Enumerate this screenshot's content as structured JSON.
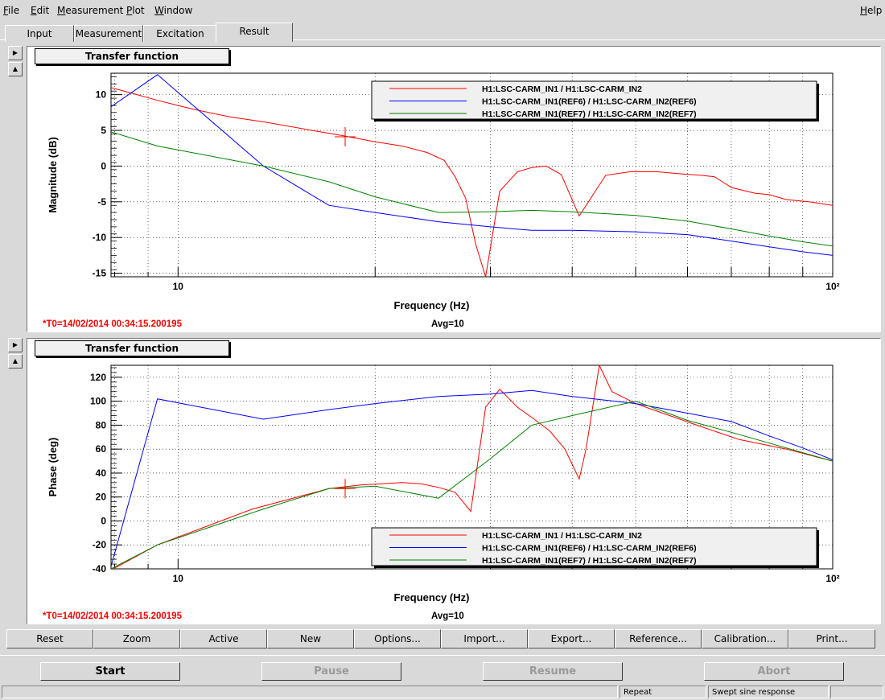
{
  "menubar": {
    "items": [
      {
        "label": "File",
        "key": "F"
      },
      {
        "label": "Edit",
        "key": "E"
      },
      {
        "label": "Measurement",
        "key": "M"
      },
      {
        "label": "Plot",
        "key": "P"
      },
      {
        "label": "Window",
        "key": "W"
      }
    ],
    "help": "Help"
  },
  "tabs": [
    {
      "label": "Input"
    },
    {
      "label": "Measurement"
    },
    {
      "label": "Excitation"
    },
    {
      "label": "Result"
    }
  ],
  "plots": [
    {
      "panel_title": "Transfer function",
      "timestamp": "*T0=14/02/2014 00:34:15.200195",
      "avg": "Avg=10"
    },
    {
      "panel_title": "Transfer function",
      "timestamp": "*T0=14/02/2014 00:34:15.200195",
      "avg": "Avg=10"
    }
  ],
  "chart_data": [
    {
      "type": "line",
      "xlabel": "Frequency (Hz)",
      "ylabel": "Magnitude (dB)",
      "xscale": "log",
      "xlim": [
        7.9,
        100
      ],
      "ylim": [
        -15.5,
        13
      ],
      "xticks": [
        {
          "value": 10,
          "label": "10"
        },
        {
          "value": 100,
          "label": "10²"
        }
      ],
      "yticks": [
        -15,
        -10,
        -5,
        0,
        5,
        10
      ],
      "grid": true,
      "legend_position": "top-right",
      "cursor": {
        "x": 18.0,
        "y": 4.1
      },
      "series": [
        {
          "name": "H1:LSC-CARM_IN1 / H1:LSC-CARM_IN2",
          "color": "#ff0000",
          "x": [
            7.9,
            8.5,
            9.3,
            10.5,
            12,
            13.5,
            16,
            18,
            20,
            22,
            24,
            25.5,
            26.5,
            27.5,
            28.5,
            29.5,
            31,
            33,
            34.7,
            36.5,
            38.5,
            41,
            45,
            49,
            54,
            59,
            63,
            66,
            70,
            76,
            80,
            85,
            92,
            100
          ],
          "y": [
            11,
            10.2,
            9.2,
            8,
            6.9,
            6.2,
            5,
            4.2,
            3.4,
            2.8,
            1.9,
            0.8,
            -1.5,
            -4.5,
            -11,
            -15.5,
            -3.5,
            -0.8,
            -0.2,
            0,
            -1.2,
            -7,
            -1.3,
            -0.8,
            -0.8,
            -1.1,
            -1.3,
            -1.5,
            -3,
            -3.8,
            -4,
            -4.7,
            -5,
            -5.5
          ]
        },
        {
          "name": "H1:LSC-CARM_IN1(REF6) / H1:LSC-CARM_IN2(REF6)",
          "color": "#0000ff",
          "x": [
            7.9,
            9.3,
            13.5,
            17,
            20,
            25,
            30,
            34.7,
            40,
            50,
            60,
            70,
            80,
            90,
            100
          ],
          "y": [
            8.3,
            12.8,
            0,
            -5.5,
            -6.5,
            -7.8,
            -8.5,
            -9,
            -9,
            -9.2,
            -9.6,
            -10.5,
            -11.3,
            -12,
            -12.5
          ]
        },
        {
          "name": "H1:LSC-CARM_IN1(REF7) / H1:LSC-CARM_IN2(REF7)",
          "color": "#008000",
          "x": [
            7.9,
            9.3,
            13.5,
            17,
            20,
            25,
            30,
            34.7,
            40,
            50,
            60,
            70,
            80,
            90,
            100
          ],
          "y": [
            4.8,
            2.8,
            0,
            -2.2,
            -4.3,
            -6.5,
            -6.4,
            -6.2,
            -6.4,
            -6.9,
            -7.7,
            -8.8,
            -9.8,
            -10.6,
            -11.2
          ]
        }
      ]
    },
    {
      "type": "line",
      "xlabel": "Frequency (Hz)",
      "ylabel": "Phase (deg)",
      "xscale": "log",
      "xlim": [
        7.9,
        100
      ],
      "ylim": [
        -40,
        130
      ],
      "xticks": [
        {
          "value": 10,
          "label": "10"
        },
        {
          "value": 100,
          "label": "10²"
        }
      ],
      "yticks": [
        -40,
        -20,
        0,
        20,
        40,
        60,
        80,
        100,
        120
      ],
      "grid": true,
      "legend_position": "bottom-right",
      "cursor": {
        "x": 18.0,
        "y": 27
      },
      "series": [
        {
          "name": "H1:LSC-CARM_IN1 / H1:LSC-CARM_IN2",
          "color": "#ff0000",
          "x": [
            7.9,
            9.3,
            13,
            17,
            19,
            20.5,
            22,
            23.5,
            25,
            26.5,
            28,
            29.5,
            31,
            33,
            35,
            37,
            39,
            41,
            42,
            44,
            46,
            50,
            55,
            62,
            72,
            85,
            100
          ],
          "y": [
            -41,
            -20,
            10,
            27,
            30,
            31,
            32,
            31,
            28,
            24,
            8,
            95,
            110,
            95,
            85,
            75,
            60,
            35,
            60,
            130,
            108,
            98,
            90,
            80,
            68,
            60,
            50
          ]
        },
        {
          "name": "H1:LSC-CARM_IN1(REF6) / H1:LSC-CARM_IN2(REF6)",
          "color": "#0000ff",
          "x": [
            7.9,
            9.3,
            13.5,
            17,
            20,
            25,
            30,
            34.7,
            40,
            50,
            60,
            70,
            80,
            90,
            100
          ],
          "y": [
            -38,
            102,
            85,
            93,
            98,
            104,
            106,
            109,
            104,
            98,
            90,
            83,
            71,
            61,
            51
          ]
        },
        {
          "name": "H1:LSC-CARM_IN1(REF7) / H1:LSC-CARM_IN2(REF7)",
          "color": "#008000",
          "x": [
            7.9,
            9.3,
            13.5,
            17,
            20,
            25,
            30,
            34.7,
            40,
            50,
            60,
            70,
            80,
            90,
            100
          ],
          "y": [
            -40,
            -20,
            10,
            27,
            29,
            19,
            52,
            80,
            88,
            100,
            84,
            74,
            65,
            57,
            50
          ]
        }
      ]
    }
  ],
  "bottom_buttons": [
    {
      "label": "Reset"
    },
    {
      "label": "Zoom"
    },
    {
      "label": "Active"
    },
    {
      "label": "New"
    },
    {
      "label": "Options..."
    },
    {
      "label": "Import..."
    },
    {
      "label": "Export..."
    },
    {
      "label": "Reference..."
    },
    {
      "label": "Calibration..."
    },
    {
      "label": "Print..."
    }
  ],
  "controls": [
    {
      "label": "Start",
      "enabled": true
    },
    {
      "label": "Pause",
      "enabled": false
    },
    {
      "label": "Resume",
      "enabled": false
    },
    {
      "label": "Abort",
      "enabled": false
    }
  ],
  "status": {
    "mode": "Repeat",
    "measurement": "Swept sine response"
  }
}
